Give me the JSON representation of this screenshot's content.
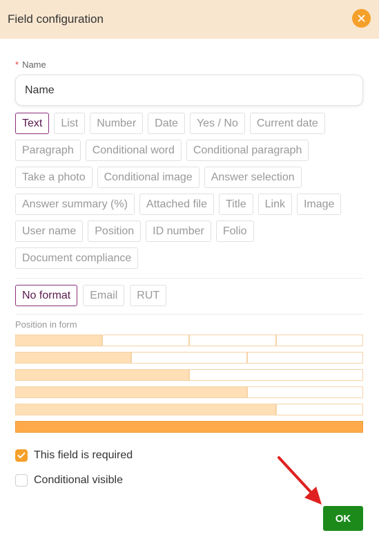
{
  "dialog": {
    "title": "Field configuration",
    "close_icon": "close-icon",
    "accent_color": "#f5a02a",
    "header_bg": "#f8e6cf"
  },
  "name_field": {
    "required_mark": "*",
    "label": "Name",
    "value": "Name"
  },
  "field_types": [
    {
      "label": "Text",
      "selected": true
    },
    {
      "label": "List"
    },
    {
      "label": "Number"
    },
    {
      "label": "Date"
    },
    {
      "label": "Yes / No"
    },
    {
      "label": "Current date"
    },
    {
      "label": "Paragraph"
    },
    {
      "label": "Conditional word"
    },
    {
      "label": "Conditional paragraph"
    },
    {
      "label": "Take a photo"
    },
    {
      "label": "Conditional image"
    },
    {
      "label": "Answer selection"
    },
    {
      "label": "Answer summary (%)"
    },
    {
      "label": "Attached file"
    },
    {
      "label": "Title"
    },
    {
      "label": "Link"
    },
    {
      "label": "Image"
    },
    {
      "label": "User name"
    },
    {
      "label": "Position"
    },
    {
      "label": "ID number"
    },
    {
      "label": "Folio"
    },
    {
      "label": "Document compliance"
    }
  ],
  "formats": [
    {
      "label": "No format",
      "selected": true
    },
    {
      "label": "Email"
    },
    {
      "label": "RUT"
    }
  ],
  "position": {
    "label": "Position in form",
    "rows": [
      {
        "columns": 4,
        "selected_span": 1
      },
      {
        "columns": 3,
        "selected_span": 1
      },
      {
        "columns": 2,
        "selected_span": 1
      },
      {
        "columns": 3,
        "selected_span": 2
      },
      {
        "columns": 4,
        "selected_span": 3
      },
      {
        "columns": 1,
        "selected_span": 1
      }
    ]
  },
  "options": {
    "required_label": "This field is required",
    "required_checked": true,
    "conditional_label": "Conditional visible",
    "conditional_checked": false
  },
  "ok_button": {
    "label": "OK",
    "color": "#1b8a1b"
  },
  "annotation": {
    "arrow_icon": "red-arrow-icon",
    "color": "#e02020"
  }
}
